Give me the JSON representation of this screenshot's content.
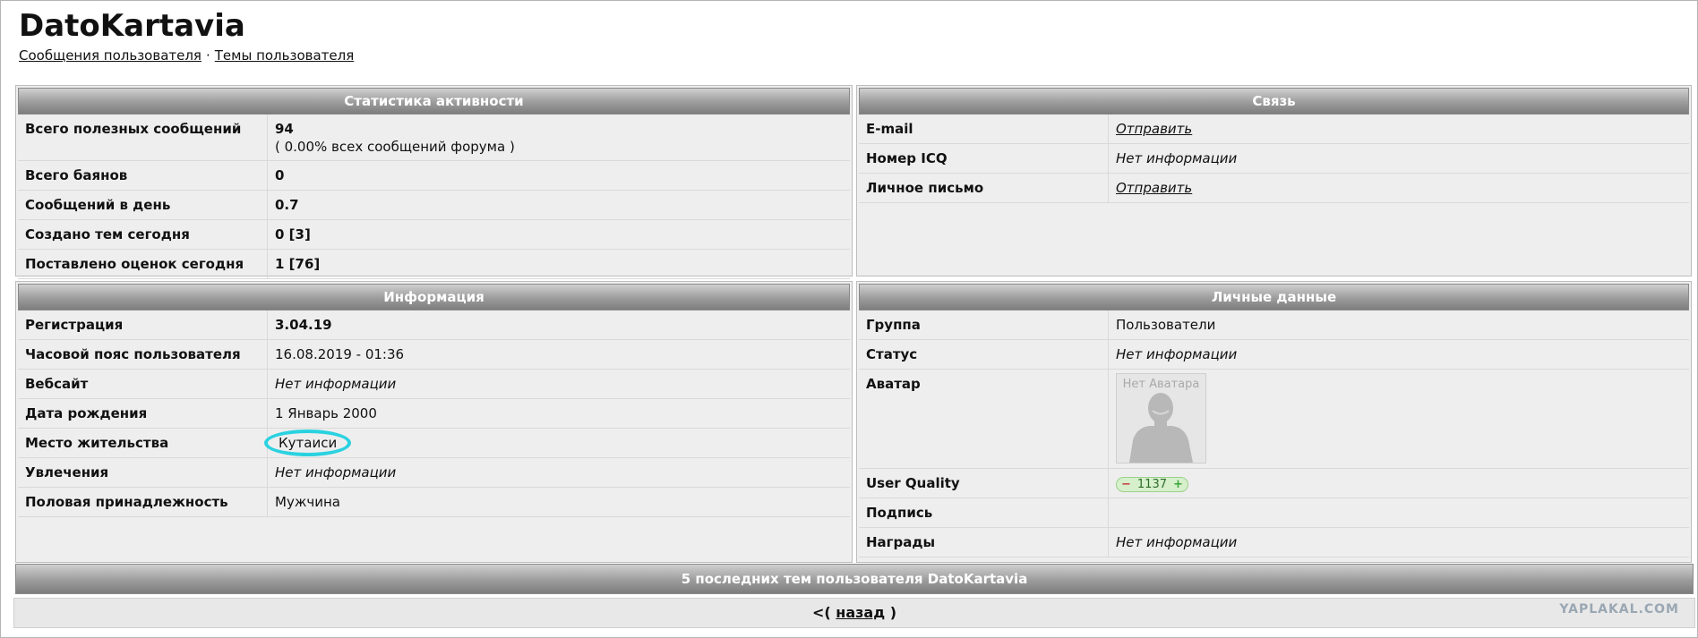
{
  "header": {
    "title": "DatoKartavia",
    "links": [
      "Сообщения пользователя",
      "Темы пользователя"
    ],
    "separator": "·"
  },
  "activity": {
    "title": "Статистика активности",
    "rows": [
      {
        "label": "Всего полезных сообщений",
        "value": "94",
        "sub": "( 0.00% всех сообщений форума )"
      },
      {
        "label": "Всего баянов",
        "value": "0"
      },
      {
        "label": "Сообщений в день",
        "value": "0.7"
      },
      {
        "label": "Создано тем сегодня",
        "value": "0 [3]"
      },
      {
        "label": "Поставлено оценок сегодня",
        "value": "1 [76]"
      }
    ]
  },
  "contact": {
    "title": "Связь",
    "rows": [
      {
        "label": "E-mail",
        "value": "Отправить"
      },
      {
        "label": "Номер ICQ",
        "value": "Нет информации"
      },
      {
        "label": "Личное письмо",
        "value": "Отправить"
      }
    ]
  },
  "info": {
    "title": "Информация",
    "rows": [
      {
        "label": "Регистрация",
        "value": "3.04.19"
      },
      {
        "label": "Часовой пояс пользователя",
        "value": "16.08.2019 - 01:36"
      },
      {
        "label": "Вебсайт",
        "value": "Нет информации"
      },
      {
        "label": "Дата рождения",
        "value": "1 Январь 2000"
      },
      {
        "label": "Место жительства",
        "value": "Кутаиси"
      },
      {
        "label": "Увлечения",
        "value": "Нет информации"
      },
      {
        "label": "Половая принадлежность",
        "value": "Мужчина"
      }
    ]
  },
  "personal": {
    "title": "Личные данные",
    "rows": [
      {
        "label": "Группа",
        "value": "Пользователи"
      },
      {
        "label": "Статус",
        "value": "Нет информации"
      },
      {
        "label": "Аватар",
        "value": "Нет Аватара"
      },
      {
        "label": "User Quality",
        "value": "1137",
        "minus": "−",
        "plus": "+"
      },
      {
        "label": "Подпись",
        "value": ""
      },
      {
        "label": "Награды",
        "value": "Нет информации"
      }
    ]
  },
  "recent": {
    "title": "5 последних тем пользователя DatoKartavia"
  },
  "back": {
    "prefix": "<(",
    "link": "назад",
    "suffix": ")"
  },
  "watermark": "YAPLAKAL.COM",
  "colors": {
    "header_bar": "#9c9c9c",
    "panel_bg": "#eeeeee",
    "highlight_circle": "#2ad2e0"
  }
}
